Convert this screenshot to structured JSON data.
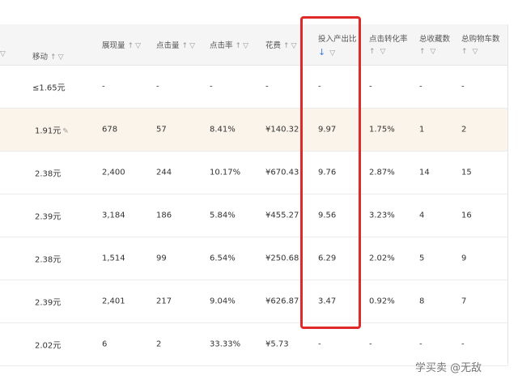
{
  "columns": [
    {
      "key": "mobile",
      "label": "移动"
    },
    {
      "key": "impressions",
      "label": "展现量"
    },
    {
      "key": "clicks",
      "label": "点击量"
    },
    {
      "key": "ctr",
      "label": "点击率"
    },
    {
      "key": "cost",
      "label": "花费"
    },
    {
      "key": "roi",
      "label": "投入产出比"
    },
    {
      "key": "cvr",
      "label": "点击转化率"
    },
    {
      "key": "favorites",
      "label": "总收藏数"
    },
    {
      "key": "cart",
      "label": "总购物车数"
    }
  ],
  "icons": {
    "sort_up": "↑",
    "sort_down_active": "↓",
    "filter": "▽",
    "edit": "✎"
  },
  "rows": [
    {
      "mobile": "≤1.65元",
      "impressions": "-",
      "clicks": "-",
      "ctr": "-",
      "cost": "-",
      "roi": "-",
      "cvr": "-",
      "favorites": "-",
      "cart": "-"
    },
    {
      "mobile": "1.91元",
      "impressions": "678",
      "clicks": "57",
      "ctr": "8.41%",
      "cost": "¥140.32",
      "roi": "9.97",
      "cvr": "1.75%",
      "favorites": "1",
      "cart": "2"
    },
    {
      "mobile": "2.38元",
      "impressions": "2,400",
      "clicks": "244",
      "ctr": "10.17%",
      "cost": "¥670.43",
      "roi": "9.76",
      "cvr": "2.87%",
      "favorites": "14",
      "cart": "15"
    },
    {
      "mobile": "2.39元",
      "impressions": "3,184",
      "clicks": "186",
      "ctr": "5.84%",
      "cost": "¥455.27",
      "roi": "9.56",
      "cvr": "3.23%",
      "favorites": "4",
      "cart": "16"
    },
    {
      "mobile": "2.38元",
      "impressions": "1,514",
      "clicks": "99",
      "ctr": "6.54%",
      "cost": "¥250.68",
      "roi": "6.29",
      "cvr": "2.02%",
      "favorites": "5",
      "cart": "9"
    },
    {
      "mobile": "2.39元",
      "impressions": "2,401",
      "clicks": "217",
      "ctr": "9.04%",
      "cost": "¥626.87",
      "roi": "3.47",
      "cvr": "0.92%",
      "favorites": "8",
      "cart": "7"
    },
    {
      "mobile": "2.02元",
      "impressions": "6",
      "clicks": "2",
      "ctr": "33.33%",
      "cost": "¥5.73",
      "roi": "-",
      "cvr": "-",
      "favorites": "-",
      "cart": "-"
    }
  ],
  "watermark": "学买卖 @无敌",
  "colors": {
    "highlight_box": "#e02a2a",
    "active_sort": "#3d7ee8",
    "selected_row": "#fbf4ea"
  }
}
